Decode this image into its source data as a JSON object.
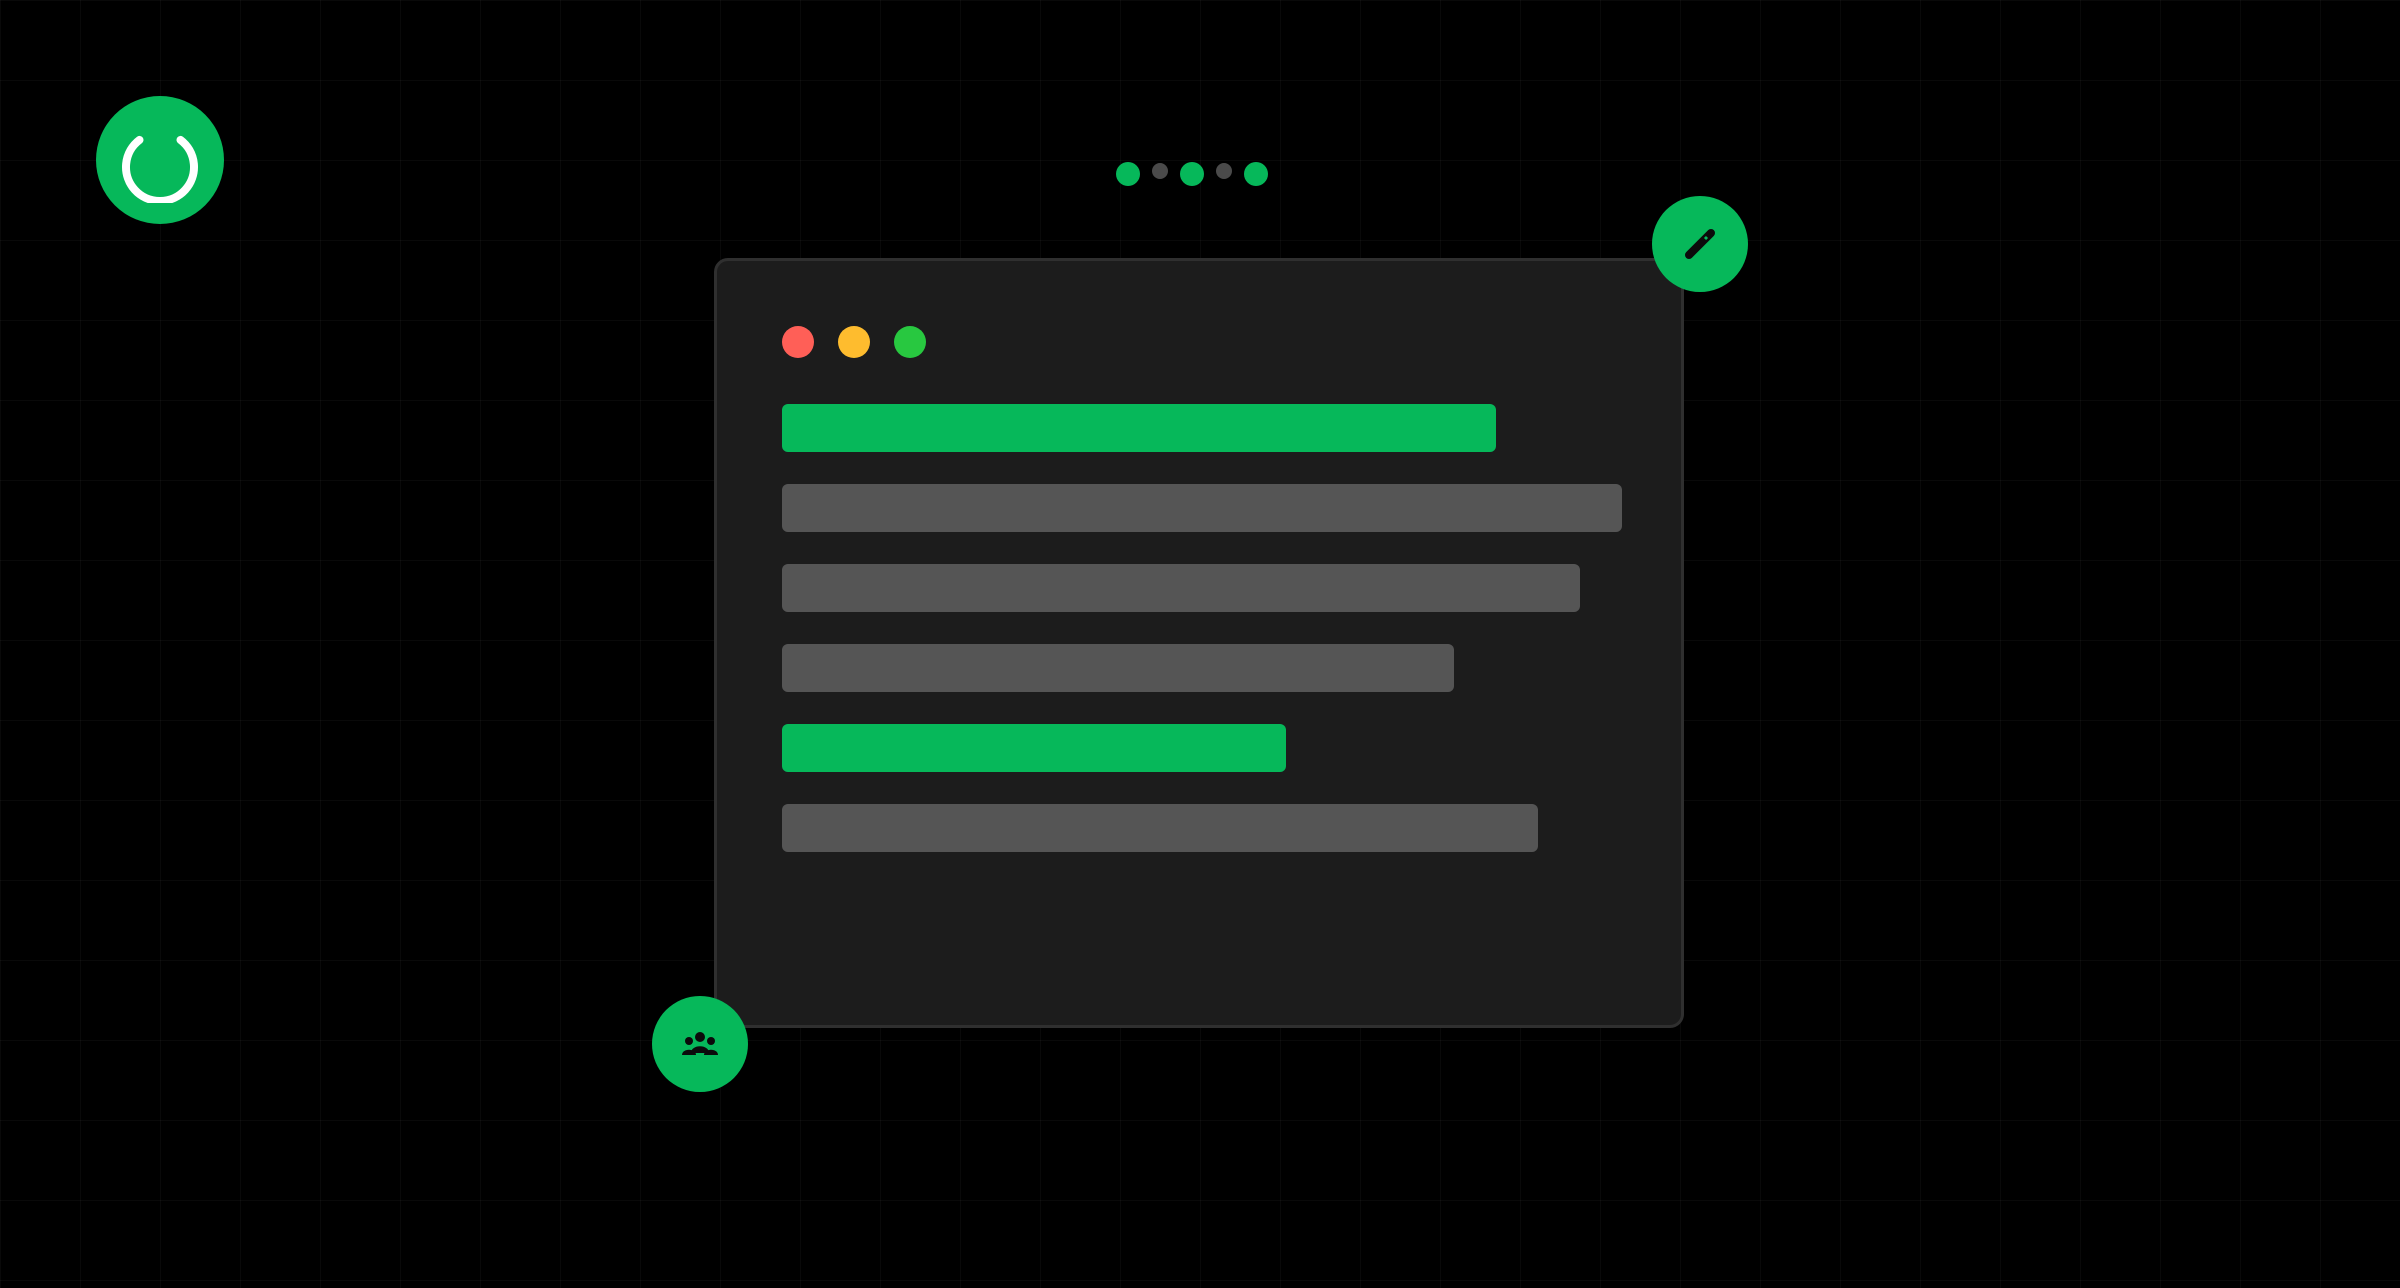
{
  "colors": {
    "background": "#000000",
    "accent": "#06B85A",
    "window_bg": "#1C1C1C",
    "window_border": "#2F2F2F",
    "placeholder_gray": "#555555",
    "dot_inactive": "#4A4A4A",
    "traffic_red": "#FF5F57",
    "traffic_yellow": "#FEBC2E",
    "traffic_green": "#28C840"
  },
  "icons": {
    "loading": "loading-spinner-icon",
    "edit": "pencil-icon",
    "team": "team-icon"
  },
  "pager": {
    "dots": [
      {
        "active": true
      },
      {
        "active": false
      },
      {
        "active": true
      },
      {
        "active": false
      },
      {
        "active": true
      }
    ]
  },
  "window": {
    "traffic_lights": [
      "red",
      "yellow",
      "green"
    ],
    "placeholder_lines": [
      {
        "highlight": true
      },
      {
        "highlight": false
      },
      {
        "highlight": false
      },
      {
        "highlight": false
      },
      {
        "highlight": true
      },
      {
        "highlight": false
      }
    ]
  }
}
